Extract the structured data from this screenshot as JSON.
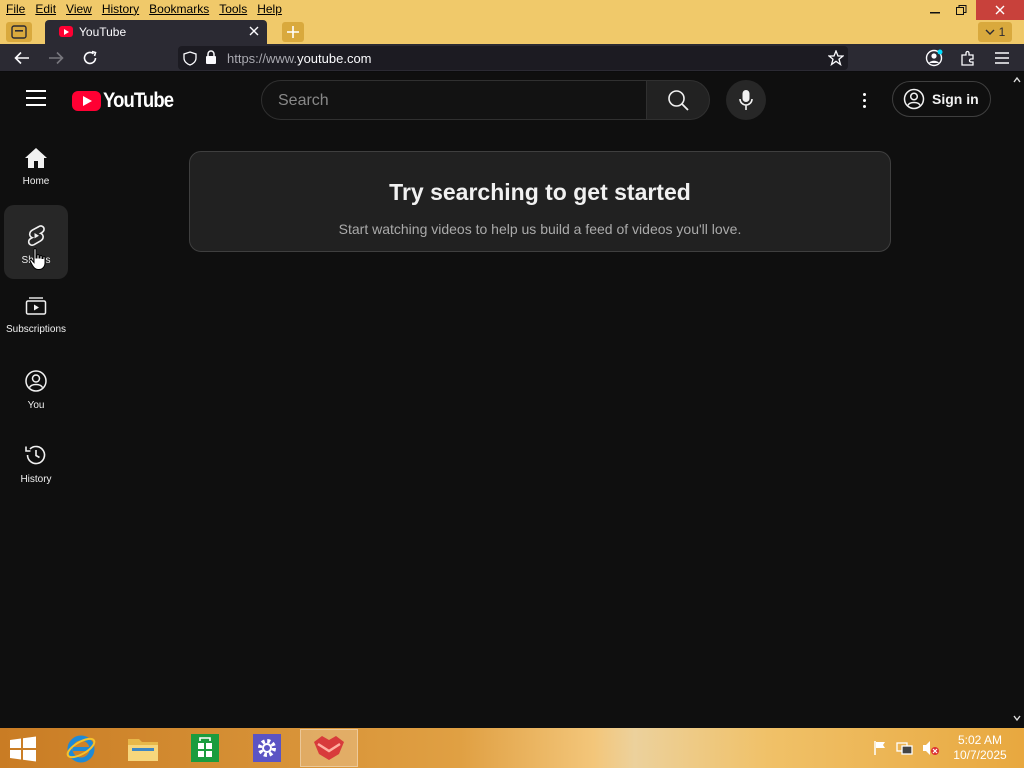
{
  "browser": {
    "menu": [
      "File",
      "Edit",
      "View",
      "History",
      "Bookmarks",
      "Tools",
      "Help"
    ],
    "tab_title": "YouTube",
    "tabs_overflow_count": "1",
    "url_prefix": "https://www.",
    "url_domain": "youtube.com"
  },
  "youtube": {
    "logo_text": "YouTube",
    "search_placeholder": "Search",
    "signin_label": "Sign in",
    "guide": [
      {
        "label": "Home",
        "icon": "home-icon"
      },
      {
        "label": "Shorts",
        "icon": "shorts-icon"
      },
      {
        "label": "Subscriptions",
        "icon": "subscriptions-icon"
      },
      {
        "label": "You",
        "icon": "you-icon"
      },
      {
        "label": "History",
        "icon": "history-icon"
      }
    ],
    "prompt": {
      "title": "Try searching to get started",
      "subtitle": "Start watching videos to help us build a feed of videos you'll love."
    }
  },
  "taskbar": {
    "apps": [
      "internet-explorer",
      "file-explorer",
      "store",
      "settings",
      "firefox"
    ],
    "time": "5:02 AM",
    "date": "10/7/2025"
  },
  "colors": {
    "accent_red": "#ff0033",
    "page_bg": "#0f0f0f",
    "chrome_yellow": "#f0c96a"
  }
}
